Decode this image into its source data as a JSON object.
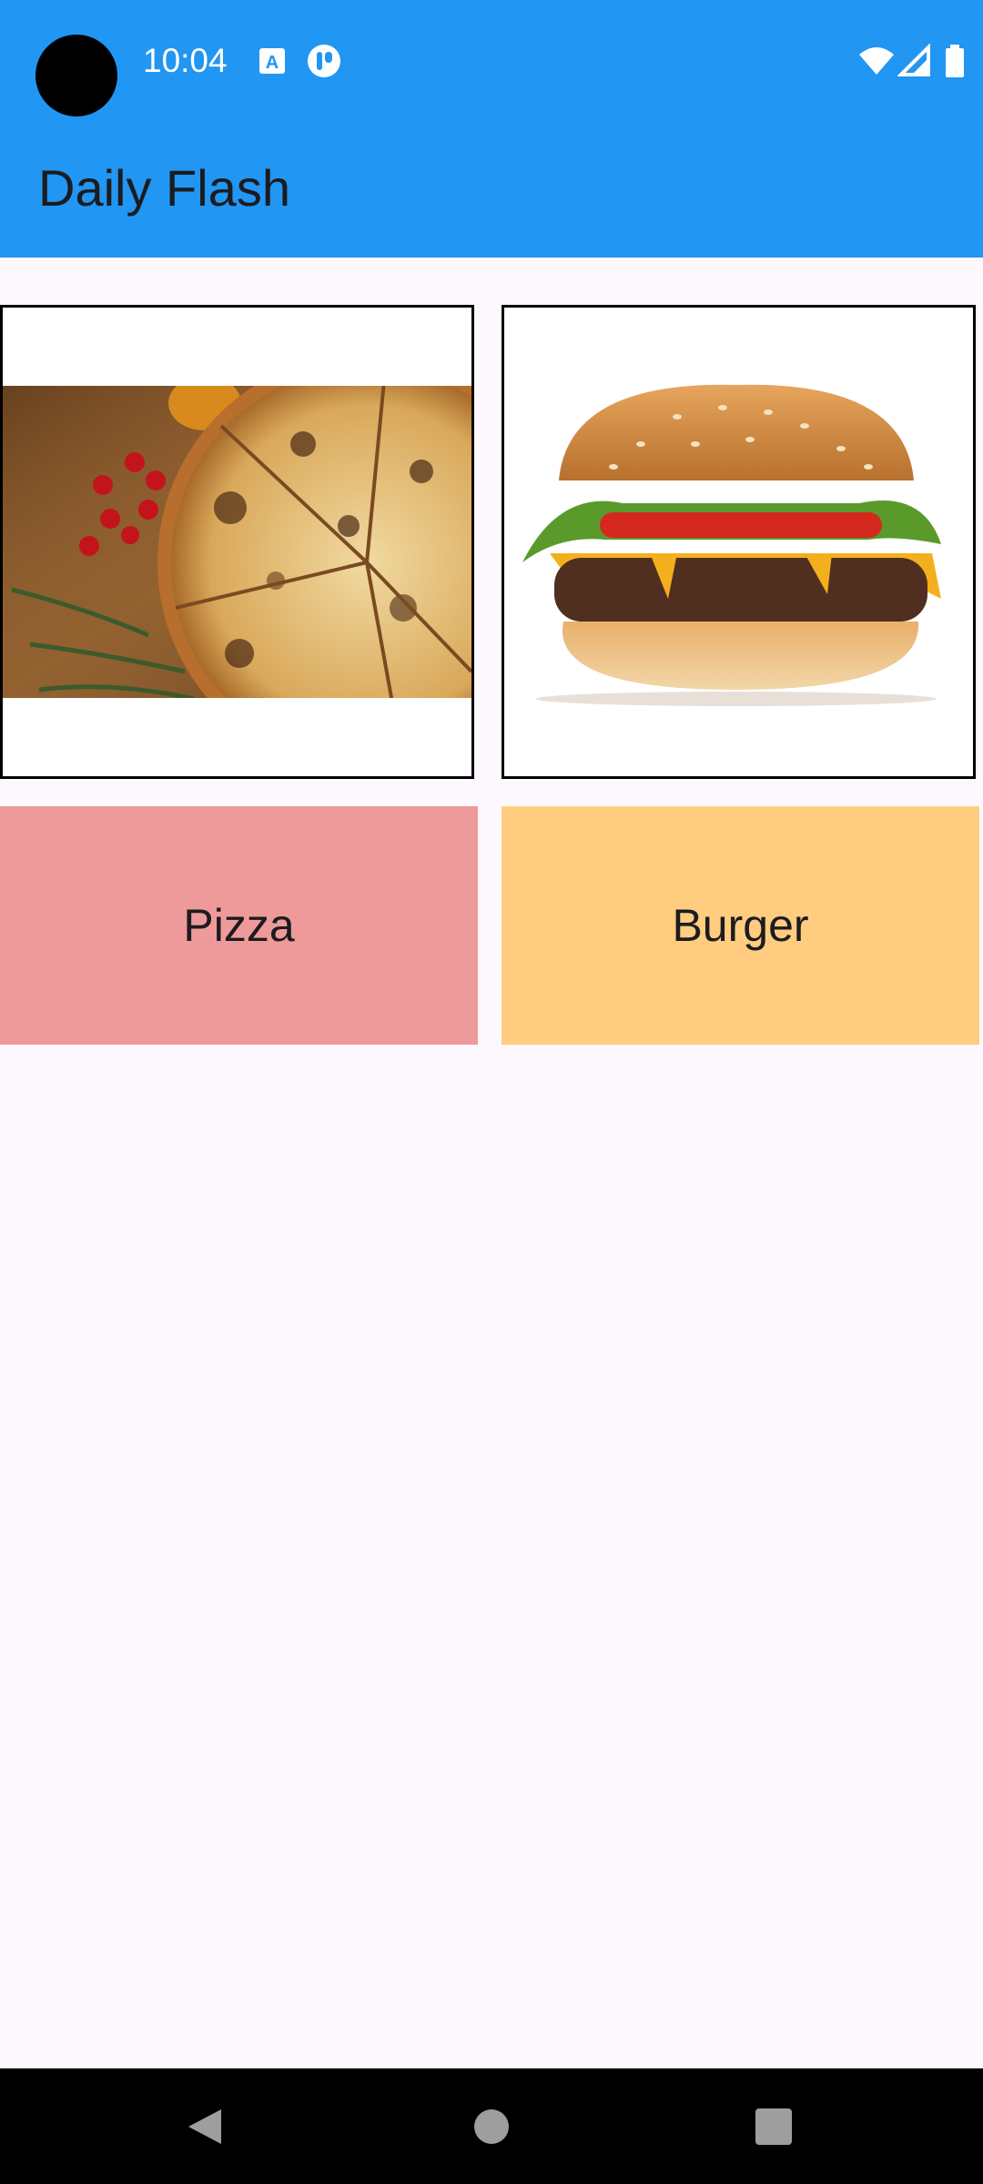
{
  "status_bar": {
    "time": "10:04",
    "left_icons": [
      "text-a-icon",
      "app-notification-icon"
    ],
    "right_icons": [
      "wifi-icon",
      "signal-icon",
      "battery-icon"
    ]
  },
  "app_bar": {
    "title": "Daily Flash",
    "color": "#2196f3"
  },
  "grid": {
    "images": [
      {
        "name": "pizza-image",
        "icon": "pizza-photo"
      },
      {
        "name": "burger-image",
        "icon": "burger-photo"
      }
    ],
    "cards": [
      {
        "label": "Pizza",
        "color": "#ef9a9a"
      },
      {
        "label": "Burger",
        "color": "#ffcc80"
      }
    ]
  },
  "nav_bar": {
    "buttons": [
      "back-icon",
      "home-icon",
      "recents-icon"
    ]
  }
}
